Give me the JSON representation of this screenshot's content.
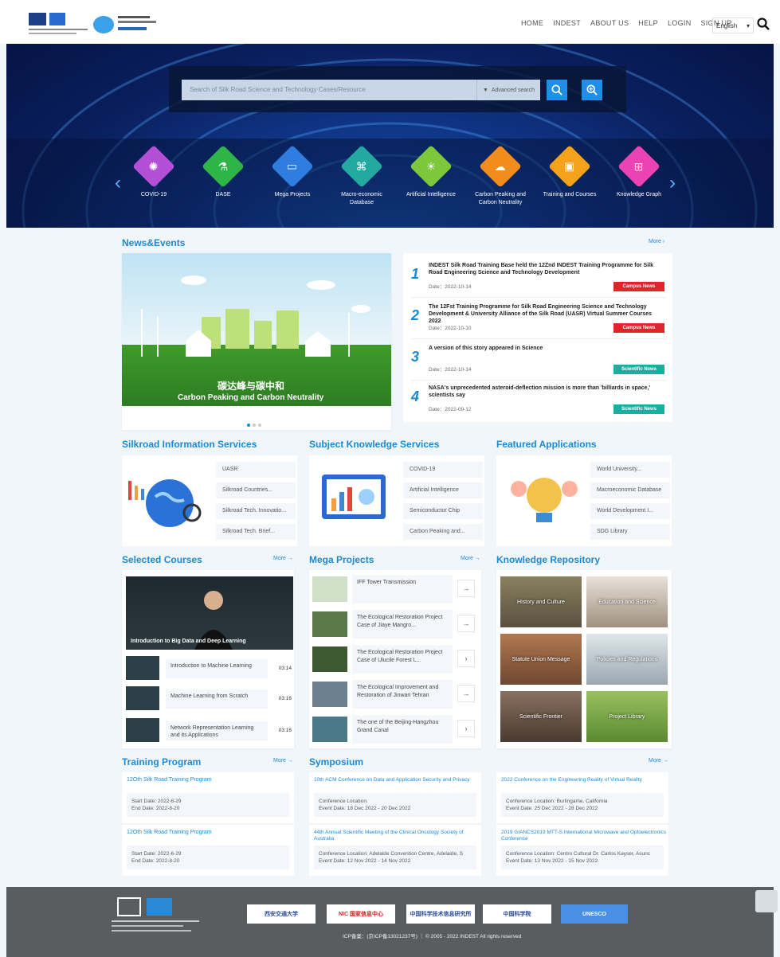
{
  "header": {
    "nav": [
      "HOME",
      "INDEST",
      "ABOUT US",
      "HELP",
      "LOGIN",
      "SIGN UP"
    ],
    "language": "English"
  },
  "search": {
    "placeholder": "Search of Silk Road Science and Technology Cases/Resource",
    "advanced_label": "Advanced search"
  },
  "categories": [
    {
      "label": "COVID-19",
      "color": "#b24fd6"
    },
    {
      "label": "DASE",
      "color": "#2db547"
    },
    {
      "label": "Mega Projects",
      "color": "#2f7de0"
    },
    {
      "label": "Macro-economic Database",
      "color": "#24a9a0"
    },
    {
      "label": "Artificial Intelligence",
      "color": "#7cc83a"
    },
    {
      "label": "Carbon Peaking and Carbon Neutrality",
      "color": "#f28c1c"
    },
    {
      "label": "Training and Courses",
      "color": "#f3a21a"
    },
    {
      "label": "Knowledge Graph",
      "color": "#e944b2"
    }
  ],
  "news": {
    "title": "News&Events",
    "more": "More",
    "image_caption_cn": "碳达峰与碳中和",
    "image_caption_en": "Carbon Peaking and Carbon Neutrality",
    "items": [
      {
        "num": "1",
        "title": "INDEST Silk Road Training Base held the 12Znd INDEST Training Programme for Silk Road Engineering Science and Technology Development",
        "date": "Date：2022-10-14",
        "tag": "Campus News",
        "tag_color": "#e0242c"
      },
      {
        "num": "2",
        "title": "The 12Fst Training Programme for Silk Road Engineering Science and Technology Development & University Alliance of the Silk Road (UASR) Virtual Summer Courses 2022",
        "date": "Date：2022-10-10",
        "tag": "Campus News",
        "tag_color": "#e0242c"
      },
      {
        "num": "3",
        "title": "A version of this story appeared in Science",
        "date": "Date：2022-10-14",
        "tag": "Scientific News",
        "tag_color": "#17b0a0"
      },
      {
        "num": "4",
        "title": "NASA's unprecedented asteroid-deflection mission is more than 'billiards in space,' scientists say",
        "date": "Date：2022-09-12",
        "tag": "Scientific News",
        "tag_color": "#17b0a0"
      }
    ]
  },
  "services": [
    {
      "title": "Silkroad Information Services",
      "items": [
        "UASR",
        "Silkroad Countries...",
        "Silkroad Tech. Innovatio...",
        "Silkroad Tech. Brief..."
      ]
    },
    {
      "title": "Subject Knowledge Services",
      "items": [
        "COVID-19",
        "Artificial Intelligence",
        "Semiconductor Chip",
        "Carbon Peaking and..."
      ]
    },
    {
      "title": "Featured Applications",
      "items": [
        "World University...",
        "Macroeconomic Database",
        "World Development I...",
        "SDG Library"
      ]
    }
  ],
  "courses": {
    "title": "Selected Courses",
    "more": "More →",
    "main_caption": "Introduction to Big Data and Deep Learning",
    "items": [
      {
        "title": "Introduction to Machine Learning",
        "dur": "03:14"
      },
      {
        "title": "Machine Learning from Scratch",
        "dur": "03:16"
      },
      {
        "title": "Network Representation Learning and its Applications",
        "dur": "03:16"
      }
    ]
  },
  "mega": {
    "title": "Mega Projects",
    "more": "More →",
    "items": [
      {
        "title": "IFF Tower Transmission",
        "arrow": "→"
      },
      {
        "title": "The Ecological Restoration Project Case of Jiaye Mangro...",
        "arrow": "→"
      },
      {
        "title": "The Ecological Restoration Project Case of Ulucile Forest L...",
        "arrow": "›"
      },
      {
        "title": "The Ecological Improvement and Restoration of Jinwan Tehran",
        "arrow": "→"
      },
      {
        "title": "The one of the Beijing-Hangzhou Grand Canal",
        "arrow": "›"
      }
    ]
  },
  "repository": {
    "title": "Knowledge Repository",
    "items": [
      "History and Culture",
      "Education and Science",
      "Statute Union Message",
      "Policies and Regulations",
      "Scientific Frontier",
      "Project Library"
    ]
  },
  "training": {
    "title": "Training Program",
    "more": "More →",
    "items": [
      {
        "name": "12Oth Silk Road Training Program",
        "start": "Start Date: 2022-6-29",
        "end": "End Date: 2022-8-20"
      },
      {
        "name": "12Oth Silk Road Training Program",
        "start": "Start Date: 2022-6-29",
        "end": "End Date: 2022-8-20"
      }
    ]
  },
  "symposium": {
    "title": "Symposium",
    "more": "More →",
    "items": [
      {
        "name": "10th ACM Conference on Data and Application Security and Privacy",
        "location": "Conference Location:",
        "dates": "Event Date: 18 Dec 2022 - 20 Dec 2022"
      },
      {
        "name": "2022 Conference on the Engineering Reality of Virtual Reality",
        "location": "Conference Location: Burlingame, California",
        "dates": "Event Date: 25 Dec 2022 - 28 Dec 2022"
      },
      {
        "name": "44th Annual Scientific Meeting of the Clinical Oncology Society of Australia",
        "location": "Conference Location: Adelaide Convention Centre, Adelaide, S",
        "dates": "Event Date: 12 Nov 2022 - 14 Nov 2022"
      },
      {
        "name": "2019 GIANCS2019 MTT-S International Microwave and Optoelectronics Conference",
        "location": "Conference Location: Centro Cultural Dr. Carlos Kayser, Asunc",
        "dates": "Event Date: 13 Nov 2022 - 15 Nov 2022"
      }
    ]
  },
  "footer": {
    "partners": [
      "西安交通大学",
      "NIC 国家信息中心",
      "中国科学技术信息研究所",
      "中国科学院",
      "UNESCO"
    ],
    "copyright": "ICP备案：(京ICP备13021237号) ｜ © 2005 - 2022 INDEST All rights reserved"
  }
}
